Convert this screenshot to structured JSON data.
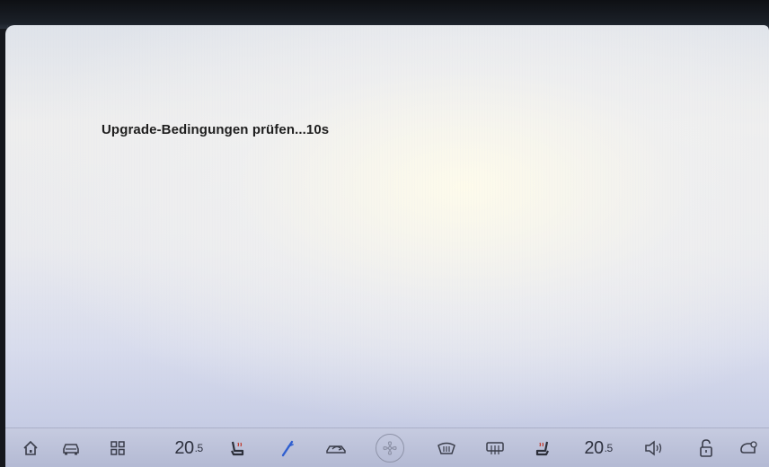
{
  "screen": {
    "status_message": "Upgrade-Bedingungen prüfen...10s"
  },
  "bottom_bar": {
    "left_temperature": {
      "whole": "20",
      "decimal": ".5"
    },
    "right_temperature": {
      "whole": "20",
      "decimal": ".5"
    },
    "icons": [
      "home-icon",
      "car-icon",
      "apps-grid-icon",
      "seat-heat-left-icon",
      "airflow-icon",
      "recirculation-icon",
      "fan-icon",
      "front-defrost-icon",
      "rear-defrost-icon",
      "seat-heat-right-icon",
      "volume-icon",
      "lock-icon",
      "car-settings-icon"
    ],
    "colors": {
      "accent_airflow": "#2f5fd0",
      "seat_heat_accent": "#c0392b"
    }
  }
}
